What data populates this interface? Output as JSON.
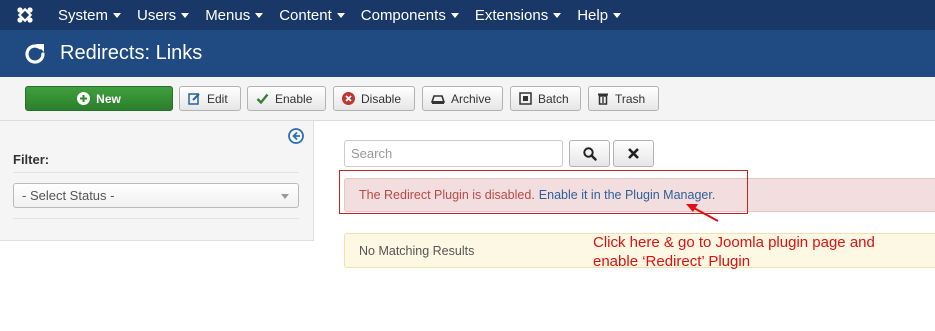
{
  "topnav": {
    "items": [
      {
        "label": "System"
      },
      {
        "label": "Users"
      },
      {
        "label": "Menus"
      },
      {
        "label": "Content"
      },
      {
        "label": "Components"
      },
      {
        "label": "Extensions"
      },
      {
        "label": "Help"
      }
    ]
  },
  "header": {
    "title": "Redirects: Links",
    "icon": "refresh-icon"
  },
  "toolbar": {
    "new_label": "New",
    "edit_label": "Edit",
    "enable_label": "Enable",
    "disable_label": "Disable",
    "archive_label": "Archive",
    "batch_label": "Batch",
    "trash_label": "Trash"
  },
  "sidebar": {
    "filter_label": "Filter:",
    "status_select_value": "- Select Status -"
  },
  "search": {
    "placeholder": "Search"
  },
  "alerts": {
    "error_text": "The Redirect Plugin is disabled.",
    "error_link": "Enable it in the Plugin Manager.",
    "warning_text": "No Matching Results"
  },
  "annotation": {
    "line1": "Click here & go to Joomla plugin page and",
    "line2": "enable ‘Redirect’ Plugin"
  },
  "colors": {
    "topnav_bg": "#1a3867",
    "header_bg": "#1f4a82",
    "new_button": "#2f8a2f",
    "annotation": "#dd1111",
    "error_bg": "#f2dede",
    "warning_bg": "#fcf8e3"
  }
}
